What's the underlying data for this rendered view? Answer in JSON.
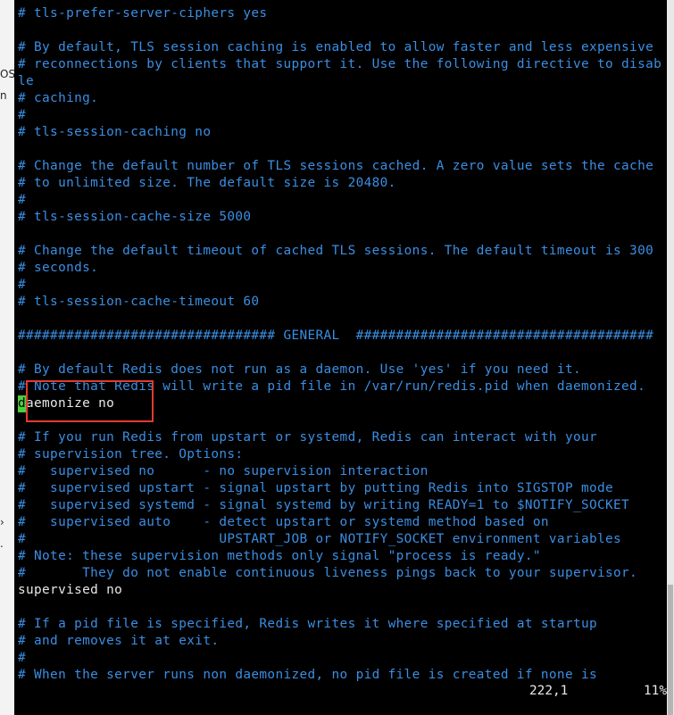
{
  "background_window": {
    "fragments": [
      "OS",
      "n",
      "›",
      "."
    ]
  },
  "editor": {
    "lines": [
      {
        "text": "# tls-prefer-server-ciphers yes",
        "kind": "comment"
      },
      {
        "text": "",
        "kind": "blank"
      },
      {
        "text": "# By default, TLS session caching is enabled to allow faster and less expensive",
        "kind": "comment"
      },
      {
        "text": "# reconnections by clients that support it. Use the following directive to disab",
        "kind": "comment"
      },
      {
        "text": "le",
        "kind": "comment"
      },
      {
        "text": "# caching.",
        "kind": "comment"
      },
      {
        "text": "#",
        "kind": "comment"
      },
      {
        "text": "# tls-session-caching no",
        "kind": "comment"
      },
      {
        "text": "",
        "kind": "blank"
      },
      {
        "text": "# Change the default number of TLS sessions cached. A zero value sets the cache",
        "kind": "comment"
      },
      {
        "text": "# to unlimited size. The default size is 20480.",
        "kind": "comment"
      },
      {
        "text": "#",
        "kind": "comment"
      },
      {
        "text": "# tls-session-cache-size 5000",
        "kind": "comment"
      },
      {
        "text": "",
        "kind": "blank"
      },
      {
        "text": "# Change the default timeout of cached TLS sessions. The default timeout is 300",
        "kind": "comment"
      },
      {
        "text": "# seconds.",
        "kind": "comment"
      },
      {
        "text": "#",
        "kind": "comment"
      },
      {
        "text": "# tls-session-cache-timeout 60",
        "kind": "comment"
      },
      {
        "text": "",
        "kind": "blank"
      },
      {
        "text": "################################ GENERAL  #####################################",
        "kind": "comment"
      },
      {
        "text": "",
        "kind": "blank"
      },
      {
        "text": "# By default Redis does not run as a daemon. Use 'yes' if you need it.",
        "kind": "comment"
      },
      {
        "text": "# Note that Redis will write a pid file in /var/run/redis.pid when daemonized.",
        "kind": "comment"
      },
      {
        "text": "aemonize no",
        "kind": "cursor-line",
        "cursor_char": "d"
      },
      {
        "text": "",
        "kind": "blank"
      },
      {
        "text": "# If you run Redis from upstart or systemd, Redis can interact with your",
        "kind": "comment"
      },
      {
        "text": "# supervision tree. Options:",
        "kind": "comment"
      },
      {
        "text": "#   supervised no      - no supervision interaction",
        "kind": "comment"
      },
      {
        "text": "#   supervised upstart - signal upstart by putting Redis into SIGSTOP mode",
        "kind": "comment"
      },
      {
        "text": "#   supervised systemd - signal systemd by writing READY=1 to $NOTIFY_SOCKET",
        "kind": "comment"
      },
      {
        "text": "#   supervised auto    - detect upstart or systemd method based on",
        "kind": "comment"
      },
      {
        "text": "#                        UPSTART_JOB or NOTIFY_SOCKET environment variables",
        "kind": "comment"
      },
      {
        "text": "# Note: these supervision methods only signal \"process is ready.\"",
        "kind": "comment"
      },
      {
        "text": "#       They do not enable continuous liveness pings back to your supervisor.",
        "kind": "comment"
      },
      {
        "text": "supervised no",
        "kind": "plain"
      },
      {
        "text": "",
        "kind": "blank"
      },
      {
        "text": "# If a pid file is specified, Redis writes it where specified at startup",
        "kind": "comment"
      },
      {
        "text": "# and removes it at exit.",
        "kind": "comment"
      },
      {
        "text": "#",
        "kind": "comment"
      },
      {
        "text": "# When the server runs non daemonized, no pid file is created if none is",
        "kind": "comment"
      }
    ],
    "colors": {
      "comment": "#3b8ee3",
      "plain": "#e8e8e8",
      "background": "#000000",
      "cursor": "#4ad03e",
      "highlight_box": "#e33b2e"
    }
  },
  "status": {
    "position": "222,1",
    "percent": "11%"
  }
}
